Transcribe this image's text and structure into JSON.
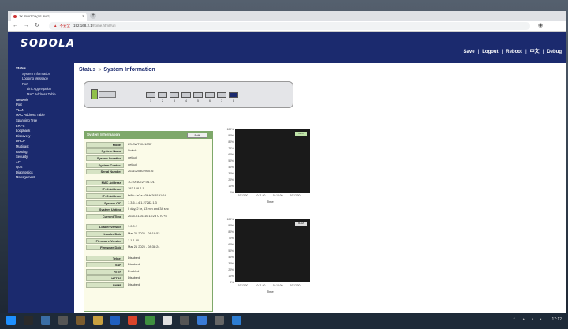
{
  "browser": {
    "tab_title": "ZK-SWITCH(ZS-8MG)",
    "tab_close": "×",
    "new_tab": "+",
    "security_label": "不安全",
    "url_host": "192.168.2.1",
    "url_path": "/home.html?uri",
    "back": "←",
    "forward": "→",
    "reload": "↻"
  },
  "header": {
    "logo": "SODOLA",
    "nav": [
      "Save",
      "Logout",
      "Reboot",
      "中文",
      "Debug"
    ]
  },
  "sidebar": {
    "items": [
      {
        "label": "Status",
        "level": 0
      },
      {
        "label": "System Information",
        "level": 1
      },
      {
        "label": "Logging Message",
        "level": 1
      },
      {
        "label": "Port",
        "level": 1
      },
      {
        "label": "Link Aggregation",
        "level": 2
      },
      {
        "label": "MAC Address Table",
        "level": 2
      },
      {
        "label": "Network",
        "level": 0
      },
      {
        "label": "Port",
        "level": 0
      },
      {
        "label": "VLAN",
        "level": 0
      },
      {
        "label": "MAC Address Table",
        "level": 0
      },
      {
        "label": "Spanning Tree",
        "level": 0
      },
      {
        "label": "ERPS",
        "level": 0
      },
      {
        "label": "Loopback",
        "level": 0
      },
      {
        "label": "Discovery",
        "level": 0
      },
      {
        "label": "DHCP",
        "level": 0
      },
      {
        "label": "Multicast",
        "level": 0
      },
      {
        "label": "Routing",
        "level": 0
      },
      {
        "label": "Security",
        "level": 0
      },
      {
        "label": "ACL",
        "level": 0
      },
      {
        "label": "QoS",
        "level": 0
      },
      {
        "label": "Diagnostics",
        "level": 0
      },
      {
        "label": "Management",
        "level": 0
      }
    ]
  },
  "breadcrumb": {
    "section": "Status",
    "separator": "»",
    "page": "System Information"
  },
  "device_panel": {
    "ports": [
      "1",
      "2",
      "3",
      "4",
      "5",
      "6",
      "7",
      "8"
    ],
    "active_port": "8"
  },
  "system_info": {
    "title": "System Information",
    "edit_label": "Edit",
    "groups": [
      [
        {
          "key": "Model",
          "value": "LS-SWT00410SF"
        },
        {
          "key": "System Name",
          "value": "Switch"
        },
        {
          "key": "System Location",
          "value": "default"
        },
        {
          "key": "System Contact",
          "value": "default"
        },
        {
          "key": "Serial Number",
          "value": "202102080290016"
        }
      ],
      [
        {
          "key": "MAC Address",
          "value": "1C:2A:A3:2F:81:D1"
        },
        {
          "key": "IPv4 Address",
          "value": "192.168.2.1"
        },
        {
          "key": "IPv6 Address",
          "value": "fe80::1e2a:a3ff:fe2f:81d1/64"
        },
        {
          "key": "System OID",
          "value": "1.3.6.1.4.1.27282.1.3"
        },
        {
          "key": "System Uptime",
          "value": "0 day, 2 hr, 13 min and 34 sec"
        },
        {
          "key": "Current Time",
          "value": "2025-01-01 10:13:23 UTC+8"
        }
      ],
      [
        {
          "key": "Loader Version",
          "value": "1.0.0.2"
        },
        {
          "key": "Loader Date",
          "value": "Mar 21 2025 - 08:18:53"
        },
        {
          "key": "Firmware Version",
          "value": "1.1.1.30"
        },
        {
          "key": "Firmware Date",
          "value": "Mar 21 2025 - 08:38:24"
        }
      ],
      [
        {
          "key": "Telnet",
          "value": "Disabled"
        },
        {
          "key": "SSH",
          "value": "Disabled"
        },
        {
          "key": "HTTP",
          "value": "Enabled"
        },
        {
          "key": "HTTPS",
          "value": "Disabled"
        },
        {
          "key": "SNMP",
          "value": "Disabled"
        }
      ]
    ]
  },
  "charts": [
    {
      "legend": "CPU",
      "yticks": [
        "100%",
        "90%",
        "80%",
        "70%",
        "60%",
        "50%",
        "40%",
        "30%",
        "20%",
        "10%",
        "0%"
      ],
      "xticks": [
        "10:13:00",
        "10:11:30",
        "10:12:00",
        "10:12:30"
      ],
      "xlabel": "Time"
    },
    {
      "legend": "RAM",
      "yticks": [
        "100%",
        "90%",
        "80%",
        "70%",
        "60%",
        "50%",
        "40%",
        "30%",
        "20%",
        "10%",
        "0%"
      ],
      "xticks": [
        "10:13:00",
        "10:11:30",
        "10:12:00",
        "10:12:30"
      ],
      "xlabel": "Time"
    }
  ],
  "taskbar": {
    "clock": "17:12"
  }
}
